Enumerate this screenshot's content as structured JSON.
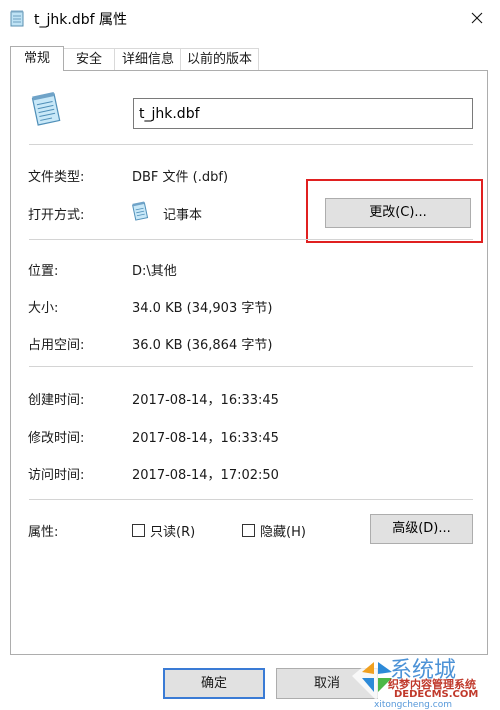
{
  "window": {
    "title": "t_jhk.dbf 属性"
  },
  "tabs": [
    {
      "label": "常规",
      "active": true
    },
    {
      "label": "安全",
      "active": false
    },
    {
      "label": "详细信息",
      "active": false
    },
    {
      "label": "以前的版本",
      "active": false
    }
  ],
  "general": {
    "file_name": "t_jhk.dbf",
    "file_type_label": "文件类型:",
    "file_type_value": "DBF 文件 (.dbf)",
    "opens_with_label": "打开方式:",
    "opens_with_value": "记事本",
    "change_button": "更改(C)...",
    "location_label": "位置:",
    "location_value": "D:\\其他",
    "size_label": "大小:",
    "size_value": "34.0 KB (34,903 字节)",
    "size_on_disk_label": "占用空间:",
    "size_on_disk_value": "36.0 KB (36,864 字节)",
    "created_label": "创建时间:",
    "created_value": "2017-08-14，16:33:45",
    "modified_label": "修改时间:",
    "modified_value": "2017-08-14，16:33:45",
    "accessed_label": "访问时间:",
    "accessed_value": "2017-08-14，17:02:50",
    "attributes_label": "属性:",
    "readonly_label": "只读(R)",
    "readonly_checked": false,
    "hidden_label": "隐藏(H)",
    "hidden_checked": false,
    "advanced_button": "高级(D)..."
  },
  "footer": {
    "ok_label": "确定",
    "cancel_label": "取消"
  },
  "watermark": {
    "brand": "系统城",
    "line1": "织梦内容管理系统",
    "line2": "DEDECMS.COM",
    "line3": "xitongcheng.com"
  },
  "colors": {
    "highlight_box": "#e02020",
    "default_button_border": "#3a7bd5"
  }
}
